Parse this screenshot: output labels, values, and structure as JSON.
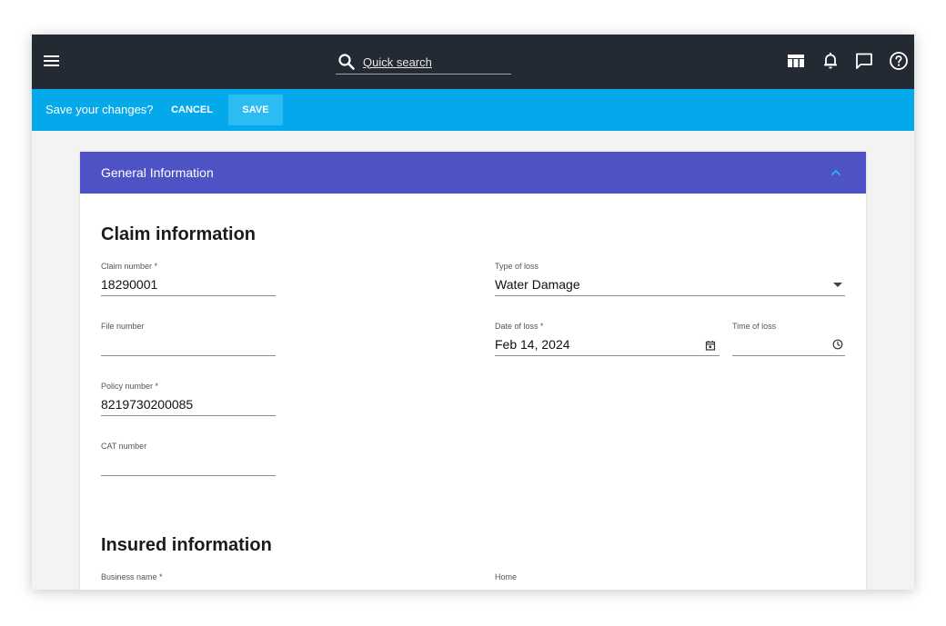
{
  "topbar": {
    "search_placeholder": "Quick search",
    "icons": [
      "menu-icon",
      "search-icon",
      "table-icon",
      "bell-icon",
      "chat-icon",
      "help-icon"
    ]
  },
  "save_bar": {
    "prompt": "Save your changes?",
    "cancel_label": "CANCEL",
    "save_label": "SAVE"
  },
  "card": {
    "title": "General Information",
    "claim_section": {
      "heading": "Claim information",
      "fields": {
        "claim_number": {
          "label": "Claim number *",
          "value": "18290001"
        },
        "type_of_loss": {
          "label": "Type of loss",
          "value": "Water Damage"
        },
        "file_number": {
          "label": "File number",
          "value": ""
        },
        "date_of_loss": {
          "label": "Date of loss *",
          "value": "Feb 14, 2024"
        },
        "time_of_loss": {
          "label": "Time of loss",
          "value": ""
        },
        "policy_number": {
          "label": "Policy number *",
          "value": "8219730200085"
        },
        "cat_number": {
          "label": "CAT number",
          "value": ""
        }
      }
    },
    "insured_section": {
      "heading": "Insured information",
      "fields": {
        "business_name": {
          "label": "Business name *",
          "value": ""
        },
        "home": {
          "label": "Home",
          "value": ""
        }
      }
    }
  },
  "colors": {
    "topbar": "#242a33",
    "save_bar": "#04a9ec",
    "save_button": "#2dbbf3",
    "card_header": "#4e52c4",
    "chevron": "#29b6f6"
  }
}
